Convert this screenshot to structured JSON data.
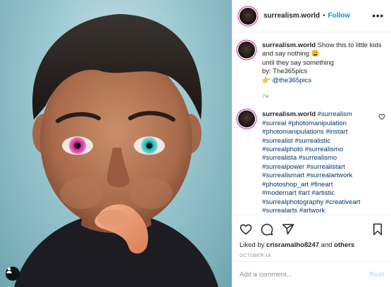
{
  "photo": {
    "alt_icon": "user-tag-icon"
  },
  "header": {
    "username": "surrealism.world",
    "separator": "•",
    "follow_label": "Follow",
    "more_label": "•••"
  },
  "caption": {
    "username": "surrealism.world",
    "line1": "Show this to little kids and say nothing 😩",
    "line2": "until they say something",
    "line3": "by: The365pics",
    "mention_icon": "pointing-hand-emoji",
    "mention_emoji": "👉",
    "mention": "@the365pics",
    "age": "7w"
  },
  "hashtag_comment": {
    "username": "surrealism.world",
    "tags": [
      "#surrealism",
      "#surreal",
      "#photomanipulation",
      "#photomanipulations",
      "#instart",
      "#surrealist",
      "#surrealistic",
      "#surrealphoto",
      "#surrealismo",
      "#surrealista",
      "#surrealismo",
      "#surrealpower",
      "#surrealistart",
      "#surrealismart",
      "#surrealartwork",
      "#photoshop_art",
      "#fineart",
      "#modernart",
      "#art",
      "#artistic",
      "#surrealphotography",
      "#creativeart",
      "#surrealarts",
      "#artwork"
    ]
  },
  "actions": {
    "liked_by_prefix": "Liked by",
    "liked_by_user": "crisramalho8247",
    "liked_by_and": "and",
    "liked_by_others": "others",
    "date": "OCTOBER 16"
  },
  "add_comment": {
    "placeholder": "Add a comment...",
    "post_label": "Post"
  },
  "colors": {
    "accent": "#0095f6",
    "link": "#00376b",
    "muted": "#8e8e8e",
    "post_disabled": "#b2dffc",
    "border": "#efefef"
  }
}
